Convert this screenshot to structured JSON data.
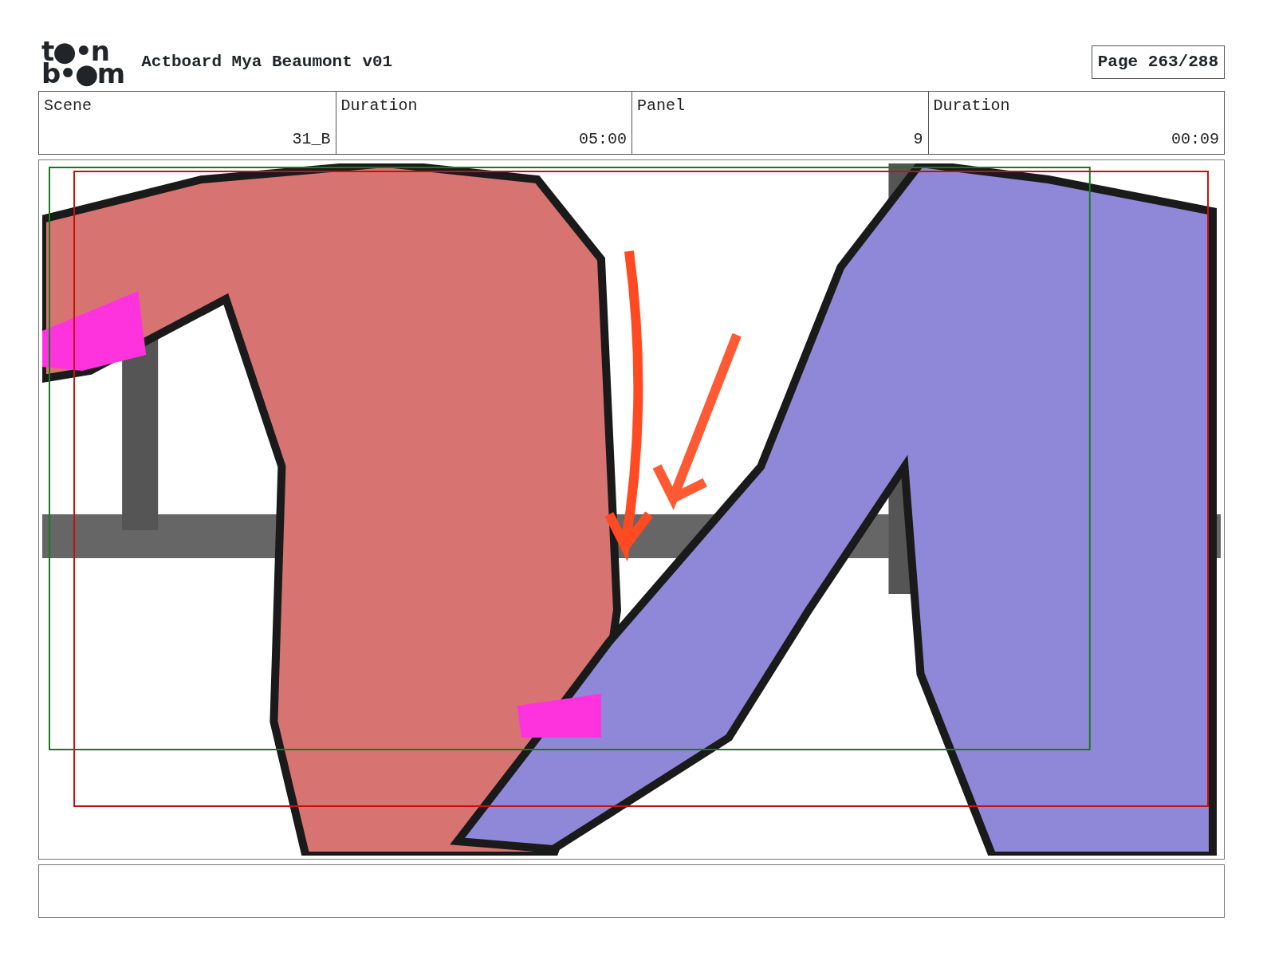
{
  "logo": {
    "lines": [
      "t●•n",
      "b•●m"
    ]
  },
  "title": "Actboard Mya Beaumont v01",
  "page": "Page 263/288",
  "info_table": {
    "columns": [
      "Scene",
      "Duration",
      "Panel",
      "Duration"
    ],
    "rows": [
      [
        "31_B",
        "05:00",
        "9",
        "00:09"
      ]
    ]
  }
}
